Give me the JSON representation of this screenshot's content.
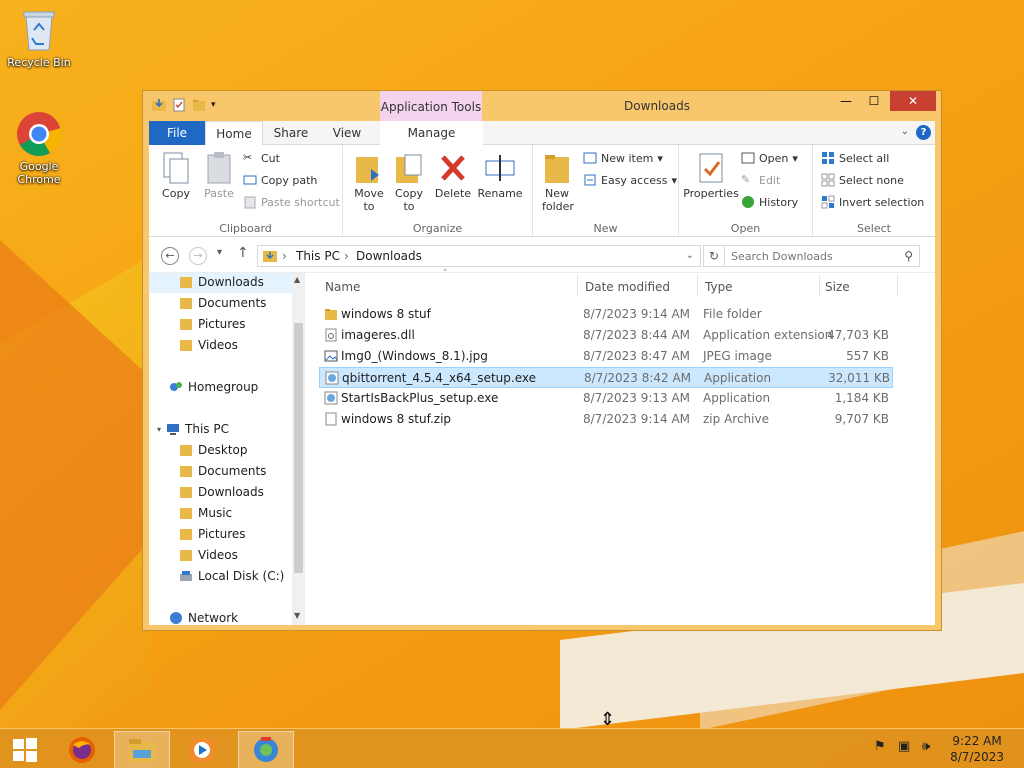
{
  "desktop": {
    "icons": [
      {
        "label": "Recycle Bin"
      },
      {
        "label": "Google Chrome"
      }
    ]
  },
  "window": {
    "title": "Downloads",
    "context_tab": "Application Tools",
    "tabs": {
      "file": "File",
      "home": "Home",
      "share": "Share",
      "view": "View",
      "manage": "Manage"
    },
    "ribbon": {
      "clipboard": {
        "label": "Clipboard",
        "copy": "Copy",
        "paste": "Paste",
        "cut": "Cut",
        "copy_path": "Copy path",
        "paste_shortcut": "Paste shortcut"
      },
      "organize": {
        "label": "Organize",
        "move_to": "Move to",
        "copy_to": "Copy to",
        "delete": "Delete",
        "rename": "Rename"
      },
      "new": {
        "label": "New",
        "new_folder": "New folder",
        "new_item": "New item",
        "easy_access": "Easy access"
      },
      "open": {
        "label": "Open",
        "properties": "Properties",
        "open": "Open",
        "edit": "Edit",
        "history": "History"
      },
      "select": {
        "label": "Select",
        "select_all": "Select all",
        "select_none": "Select none",
        "invert": "Invert selection"
      }
    },
    "address": {
      "crumbs": [
        "This PC",
        "Downloads"
      ],
      "search_placeholder": "Search Downloads"
    },
    "nav": {
      "favorites": [
        "Downloads",
        "Documents",
        "Pictures",
        "Videos"
      ],
      "homegroup": "Homegroup",
      "this_pc": "This PC",
      "this_pc_items": [
        "Desktop",
        "Documents",
        "Downloads",
        "Music",
        "Pictures",
        "Videos",
        "Local Disk (C:)"
      ],
      "network": "Network"
    },
    "columns": {
      "name": "Name",
      "date": "Date modified",
      "type": "Type",
      "size": "Size"
    },
    "files": [
      {
        "name": "windows 8 stuf",
        "date": "8/7/2023 9:14 AM",
        "type": "File folder",
        "size": "",
        "icon": "folder-icon"
      },
      {
        "name": "imageres.dll",
        "date": "8/7/2023 8:44 AM",
        "type": "Application extension",
        "size": "47,703 KB",
        "icon": "dll-icon"
      },
      {
        "name": "Img0_(Windows_8.1).jpg",
        "date": "8/7/2023 8:47 AM",
        "type": "JPEG image",
        "size": "557 KB",
        "icon": "image-icon"
      },
      {
        "name": "qbittorrent_4.5.4_x64_setup.exe",
        "date": "8/7/2023 8:42 AM",
        "type": "Application",
        "size": "32,011 KB",
        "icon": "installer-icon",
        "selected": true
      },
      {
        "name": "StartIsBackPlus_setup.exe",
        "date": "8/7/2023 9:13 AM",
        "type": "Application",
        "size": "1,184 KB",
        "icon": "installer-icon"
      },
      {
        "name": "windows 8 stuf.zip",
        "date": "8/7/2023 9:14 AM",
        "type": "zip Archive",
        "size": "9,707 KB",
        "icon": "zip-icon"
      }
    ]
  },
  "taskbar": {
    "clock_time": "9:22 AM",
    "clock_date": "8/7/2023",
    "apps": [
      "firefox-icon",
      "file-explorer-icon",
      "media-player-icon",
      "installer-icon"
    ]
  }
}
